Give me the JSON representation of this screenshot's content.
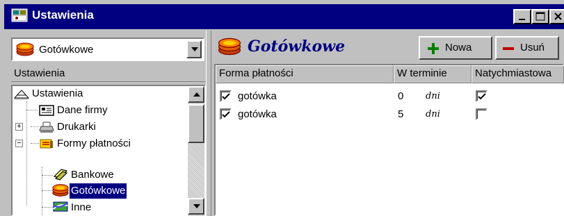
{
  "window": {
    "title": "Ustawienia",
    "buttons": [
      "minimize",
      "maximize",
      "close"
    ]
  },
  "left_pane": {
    "combo_value": "Gotówkowe",
    "header": "Ustawienia",
    "tree": [
      {
        "label": "Ustawienia",
        "icon": "settings-root-icon",
        "expander": null
      },
      {
        "label": "Dane firmy",
        "icon": "company-data-icon",
        "expander": null
      },
      {
        "label": "Drukarki",
        "icon": "printer-icon",
        "expander": "+"
      },
      {
        "label": "Formy płatności",
        "icon": "payment-forms-icon",
        "expander": "−"
      },
      {
        "label": "Bankowe",
        "icon": "bank-icon",
        "expander": null
      },
      {
        "label": "Gotówkowe",
        "icon": "cash-icon",
        "expander": null,
        "selected": true
      },
      {
        "label": "Inne",
        "icon": "other-icon",
        "expander": null
      }
    ]
  },
  "right_pane": {
    "title": "Gotówkowe",
    "toolbar": {
      "new_label": "Nowa",
      "delete_label": "Usuń"
    },
    "columns": [
      "Forma płatności",
      "W terminie",
      "Natychmiastowa"
    ],
    "rows": [
      {
        "checked": true,
        "name": "gotówka",
        "days": "0",
        "unit": "dni",
        "immediate": true
      },
      {
        "checked": true,
        "name": "gotówka",
        "days": "5",
        "unit": "dni",
        "immediate": false
      }
    ]
  },
  "colors": {
    "titlebar": "#000080",
    "face": "#c0c0c0",
    "selection": "#000080",
    "new_plus": "#008000",
    "delete_minus": "#c00000"
  }
}
